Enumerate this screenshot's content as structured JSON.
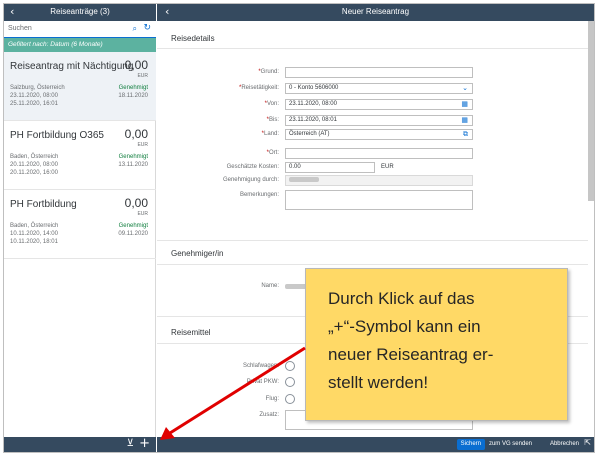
{
  "master": {
    "title": "Reiseanträge (3)",
    "search_placeholder": "Suchen",
    "filter_text": "Gefiltert nach: Datum (6 Monate)",
    "items": [
      {
        "title": "Reiseantrag mit Nächtigung",
        "amount": "0,00",
        "currency": "EUR",
        "location": "Salzburg, Österreich",
        "status": "Genehmigt",
        "start": "23.11.2020, 08:00",
        "end": "25.11.2020, 16:01",
        "created": "18.11.2020"
      },
      {
        "title": "PH Fortbildung O365",
        "amount": "0,00",
        "currency": "EUR",
        "location": "Baden, Österreich",
        "status": "Genehmigt",
        "start": "20.11.2020, 08:00",
        "end": "20.11.2020, 16:00",
        "created": "13.11.2020"
      },
      {
        "title": "PH Fortbildung",
        "amount": "0,00",
        "currency": "EUR",
        "location": "Baden, Österreich",
        "status": "Genehmigt",
        "start": "10.11.2020, 14:00",
        "end": "10.11.2020, 18:01",
        "created": "09.11.2020"
      }
    ]
  },
  "detail": {
    "title": "Neuer Reiseantrag",
    "section_reisedetails": "Reisedetails",
    "fields": {
      "grund_label": "Grund:",
      "grund_value": "",
      "reisetaetigkeit_label": "Reisetätigkeit:",
      "reisetaetigkeit_value": "0 - Konto 5606000",
      "von_label": "Von:",
      "von_value": "23.11.2020, 08:00",
      "bis_label": "Bis:",
      "bis_value": "23.11.2020, 08:01",
      "land_label": "Land:",
      "land_value": "Österreich (AT)",
      "ort_label": "Ort:",
      "ort_value": "",
      "kosten_label": "Geschätzte Kosten:",
      "kosten_value": "0.00",
      "kosten_unit": "EUR",
      "genehmigung_label": "Genehmigung durch:",
      "bemerkungen_label": "Bemerkungen:",
      "bemerkungen_value": ""
    },
    "section_genehmiger": "Genehmiger/in",
    "name_label": "Name:",
    "section_reisemittel": "Reisemittel",
    "reisemittel": {
      "schlafwagen_label": "Schlafwagen:",
      "pkw_label": "Privat PKW:",
      "flug_label": "Flug:",
      "zusatz_label": "Zusatz:"
    }
  },
  "footer": {
    "save": "Sichern",
    "send_vg": "zum VG senden",
    "cancel": "Abbrechen"
  },
  "callout": {
    "line1": "Durch Klick auf das",
    "line2": "„+“-Symbol kann ein",
    "line3": "neuer Reiseantrag er-",
    "line4": "stellt werden!"
  },
  "icons": {
    "back": "chevron-left-icon",
    "search": "search-icon",
    "refresh": "refresh-icon",
    "filter": "funnel-icon",
    "add": "plus-icon",
    "dropdown": "chevron-down-icon",
    "calendar": "calendar-icon",
    "value_help": "value-help-icon",
    "share": "share-icon"
  },
  "colors": {
    "shell": "#354a5f",
    "filter_bar": "#5cb2a0",
    "status_ok": "#107e3e",
    "accent": "#0a6ed1",
    "callout": "#ffd966",
    "arrow": "#e00000"
  }
}
